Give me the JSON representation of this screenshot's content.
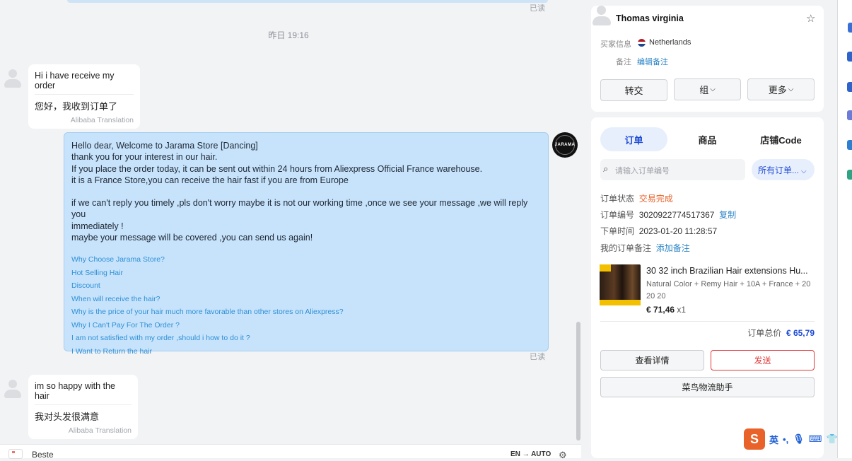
{
  "chat": {
    "read_label": "已读",
    "timestamp": "昨日 19:16",
    "messages": [
      {
        "original": "Hi i have receive my order",
        "translation": "您好，我收到订单了",
        "source": "Alibaba Translation"
      },
      {
        "original": "im so happy with the hair",
        "translation": "我对头发很满意",
        "source": "Alibaba Translation"
      }
    ],
    "store_logo_text": "JARAMA",
    "outgoing": {
      "lines_a": [
        "Hello dear, Welcome to Jarama Store [Dancing]",
        "thank you for your interest in our hair.",
        "If you place the order today, it can be sent out within 24 hours from Aliexpress Official France warehouse.",
        "it is a France Store,you can receive the hair fast if you are from Europe"
      ],
      "lines_b": [
        "if we can't reply you timely ,pls don't worry maybe it is not our working time ,once we see your message ,we will reply you",
        "immediately !",
        "maybe your message will be covered ,you can send us again!"
      ],
      "links": [
        "Why Choose Jarama Store?",
        "Hot Selling Hair",
        "Discount",
        "When will receive the hair?",
        "Why is the price of your hair much more favorable than other stores on Aliexpress?",
        "Why I Can't Pay For The Order ?",
        "I am not satisfied with my order ,should i how to do it ?",
        "I Want to Return the hair"
      ]
    },
    "input": {
      "text": "Beste",
      "lang": "EN → AUTO"
    }
  },
  "buyer": {
    "name": "Thomas virginia",
    "info_label": "买家信息",
    "country": "Netherlands",
    "note_label": "备注",
    "edit_note": "编辑备注",
    "buttons": {
      "transfer": "转交",
      "group": "组",
      "more": "更多"
    }
  },
  "orders": {
    "tabs": [
      "订单",
      "商品",
      "店铺Code"
    ],
    "search_placeholder": "请输入订单编号",
    "filter": "所有订单...",
    "status_label": "订单状态",
    "status_value": "交易完成",
    "number_label": "订单编号",
    "number_value": "3020922774517367",
    "copy": "复制",
    "time_label": "下单时间",
    "time_value": "2023-01-20 11:28:57",
    "my_note_label": "我的订单备注",
    "add_note": "添加备注",
    "product": {
      "title": "30 32 inch Brazilian Hair extensions Hu...",
      "variant": "Natural Color + Remy Hair + 10A + France + 20 20 20",
      "price": "€ 71,46",
      "qty": "x1"
    },
    "total_label": "订单总价",
    "total_value": "€ 65,79",
    "view_details": "查看详情",
    "send": "发送",
    "logistics": "菜鸟物流助手"
  },
  "ime": {
    "logo": "S",
    "mode": "英"
  },
  "colors": {
    "accent": "#1e4bd6",
    "bubble": "#c7e3fb",
    "link": "#2e8fd6",
    "status": "#e8622a",
    "danger": "#e03a3a"
  }
}
